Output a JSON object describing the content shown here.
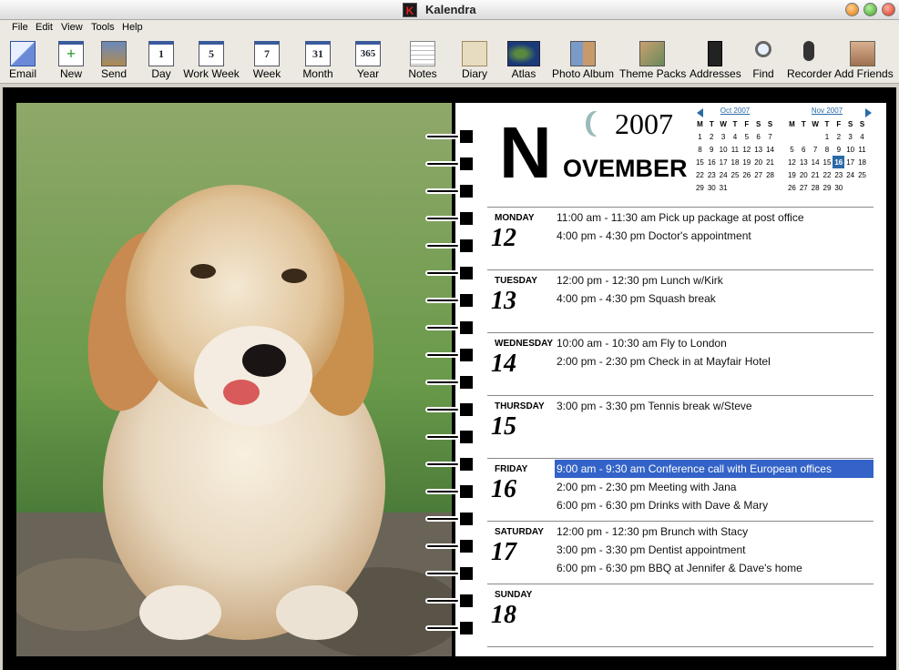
{
  "window": {
    "title": "Kalendra",
    "icon_letter": "K"
  },
  "menu": [
    "File",
    "Edit",
    "View",
    "Tools",
    "Help"
  ],
  "toolbar": [
    {
      "label": "Email",
      "icon": "email-icon"
    },
    {
      "label": "New",
      "icon": "new-icon"
    },
    {
      "label": "Send",
      "icon": "send-icon"
    },
    {
      "label": "Day",
      "icon": "day-icon",
      "num": "1"
    },
    {
      "label": "Work Week",
      "icon": "work-week-icon",
      "num": "5"
    },
    {
      "label": "Week",
      "icon": "week-icon",
      "num": "7"
    },
    {
      "label": "Month",
      "icon": "month-icon",
      "num": "31"
    },
    {
      "label": "Year",
      "icon": "year-icon",
      "num": "365"
    },
    {
      "label": "Notes",
      "icon": "notes-icon"
    },
    {
      "label": "Diary",
      "icon": "diary-icon"
    },
    {
      "label": "Atlas",
      "icon": "atlas-icon"
    },
    {
      "label": "Photo Album",
      "icon": "photo-album-icon"
    },
    {
      "label": "Theme Packs",
      "icon": "theme-packs-icon"
    },
    {
      "label": "Addresses",
      "icon": "addresses-icon"
    },
    {
      "label": "Find",
      "icon": "find-icon"
    },
    {
      "label": "Recorder",
      "icon": "recorder-icon"
    },
    {
      "label": "Add Friends",
      "icon": "add-friends-icon"
    }
  ],
  "calendar": {
    "year": "2007",
    "month_initial": "N",
    "month_rest": "OVEMBER",
    "mini_weekdays": [
      "M",
      "T",
      "W",
      "T",
      "F",
      "S",
      "S"
    ],
    "mini_prev": {
      "title": "Oct 2007",
      "weeks": [
        [
          "1",
          "2",
          "3",
          "4",
          "5",
          "6",
          "7"
        ],
        [
          "8",
          "9",
          "10",
          "11",
          "12",
          "13",
          "14"
        ],
        [
          "15",
          "16",
          "17",
          "18",
          "19",
          "20",
          "21"
        ],
        [
          "22",
          "23",
          "24",
          "25",
          "26",
          "27",
          "28"
        ],
        [
          "29",
          "30",
          "31",
          "",
          "",
          "",
          ""
        ]
      ]
    },
    "mini_next": {
      "title": "Nov 2007",
      "today": "16",
      "weeks": [
        [
          "",
          "",
          "",
          "1",
          "2",
          "3",
          "4"
        ],
        [
          "5",
          "6",
          "7",
          "8",
          "9",
          "10",
          "11"
        ],
        [
          "12",
          "13",
          "14",
          "15",
          "16",
          "17",
          "18"
        ],
        [
          "19",
          "20",
          "21",
          "22",
          "23",
          "24",
          "25"
        ],
        [
          "26",
          "27",
          "28",
          "29",
          "30",
          "",
          ""
        ]
      ]
    },
    "days": [
      {
        "name": "MONDAY",
        "num": "12",
        "events": [
          "11:00 am - 11:30 am Pick up package at post office",
          "4:00 pm - 4:30 pm Doctor's appointment"
        ]
      },
      {
        "name": "TUESDAY",
        "num": "13",
        "events": [
          "12:00 pm - 12:30 pm Lunch w/Kirk",
          "4:00 pm - 4:30 pm Squash break"
        ]
      },
      {
        "name": "WEDNESDAY",
        "num": "14",
        "events": [
          "10:00 am - 10:30 am Fly to London",
          "2:00 pm - 2:30 pm Check in at Mayfair Hotel"
        ]
      },
      {
        "name": "THURSDAY",
        "num": "15",
        "events": [
          "3:00 pm - 3:30 pm Tennis break w/Steve"
        ]
      },
      {
        "name": "FRIDAY",
        "num": "16",
        "events": [
          "9:00 am - 9:30 am Conference call with European offices",
          "2:00 pm - 2:30 pm Meeting with Jana",
          "6:00 pm - 6:30 pm Drinks with Dave & Mary"
        ],
        "selected_event": 0
      },
      {
        "name": "SATURDAY",
        "num": "17",
        "events": [
          "12:00 pm - 12:30 pm Brunch with Stacy",
          "3:00 pm - 3:30 pm Dentist appointment",
          "6:00 pm - 6:30 pm BBQ at Jennifer & Dave's home"
        ]
      },
      {
        "name": "SUNDAY",
        "num": "18",
        "events": []
      }
    ]
  },
  "colors": {
    "accent": "#3363c8",
    "mini_header": "#2a6aa8",
    "binder": "#000000"
  }
}
